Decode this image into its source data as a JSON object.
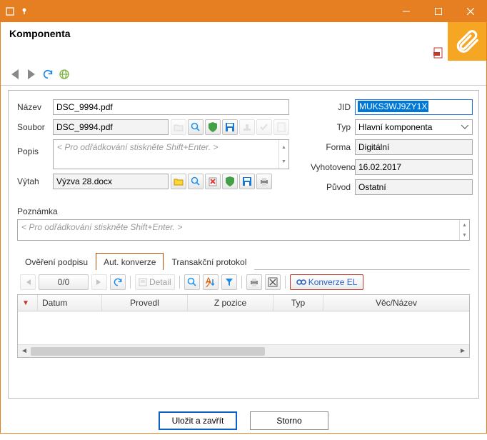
{
  "window": {
    "title": "Komponenta"
  },
  "form": {
    "nazev": {
      "label": "Název",
      "value": "DSC_9994.pdf"
    },
    "soubor": {
      "label": "Soubor",
      "value": "DSC_9994.pdf"
    },
    "popis": {
      "label": "Popis",
      "placeholder": "< Pro odřádkování stiskněte Shift+Enter. >"
    },
    "vytah": {
      "label": "Výtah",
      "value": "Výzva 28.docx"
    },
    "jid": {
      "label": "JID",
      "value": "MUKS3WJ9ZY1X"
    },
    "typ": {
      "label": "Typ",
      "value": "Hlavní komponenta"
    },
    "forma": {
      "label": "Forma",
      "value": "Digitální"
    },
    "vyhotoveno": {
      "label": "Vyhotoveno",
      "value": "16.02.2017"
    },
    "puvod": {
      "label": "Původ",
      "value": "Ostatní"
    },
    "poznamka": {
      "label": "Poznámka",
      "placeholder": "< Pro odřádkování stiskněte Shift+Enter. >"
    }
  },
  "tabs": {
    "t1": "Ověření podpisu",
    "t2": "Aut. konverze",
    "t3": "Transakční protokol"
  },
  "gridToolbar": {
    "pager": "0/0",
    "detail": "Detail",
    "konverze": "Konverze EL"
  },
  "gridColumns": {
    "datum": "Datum",
    "provedl": "Provedl",
    "zpozice": "Z pozice",
    "typ": "Typ",
    "vecnazev": "Věc/Název"
  },
  "footer": {
    "save": "Uložit a zavřít",
    "cancel": "Storno"
  }
}
